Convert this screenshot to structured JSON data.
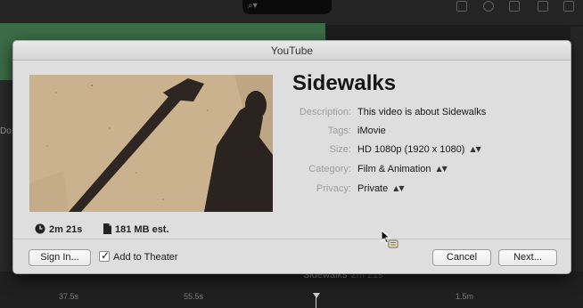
{
  "background": {
    "search_glyph": "⌕▾",
    "left_partial_label": "Do",
    "timeline": {
      "clip_title": "Sidewalks",
      "clip_duration": "2m 21s",
      "ticks": [
        "37.5s",
        "55.5s",
        "1.5m"
      ]
    }
  },
  "dialog": {
    "title": "YouTube",
    "video_title": "Sidewalks",
    "details": [
      {
        "label": "Description:",
        "value": "This video is about Sidewalks",
        "stepper": false
      },
      {
        "label": "Tags:",
        "value": "iMovie",
        "stepper": false
      },
      {
        "label": "Size:",
        "value": "HD 1080p (1920 x 1080)",
        "stepper": true
      },
      {
        "label": "Category:",
        "value": "Film & Animation",
        "stepper": true
      },
      {
        "label": "Privacy:",
        "value": "Private",
        "stepper": true
      }
    ],
    "stepper_glyph": "▲▼",
    "stats": {
      "duration": "2m 21s",
      "size_estimate": "181 MB est."
    },
    "buttons": {
      "sign_in": "Sign In...",
      "cancel": "Cancel",
      "next": "Next..."
    },
    "add_to_theater": {
      "label": "Add to Theater",
      "checked": true,
      "check_glyph": "✓"
    }
  },
  "colors": {
    "dialog_bg": "#dedede",
    "label_gray": "#9d9d9d",
    "background_dark": "#1d1d1d",
    "library_green": "#3a6d46"
  },
  "icons": {
    "duration": "clock-icon",
    "file_size": "document-icon",
    "cursor": "pointer-with-copy-badge-icon"
  }
}
